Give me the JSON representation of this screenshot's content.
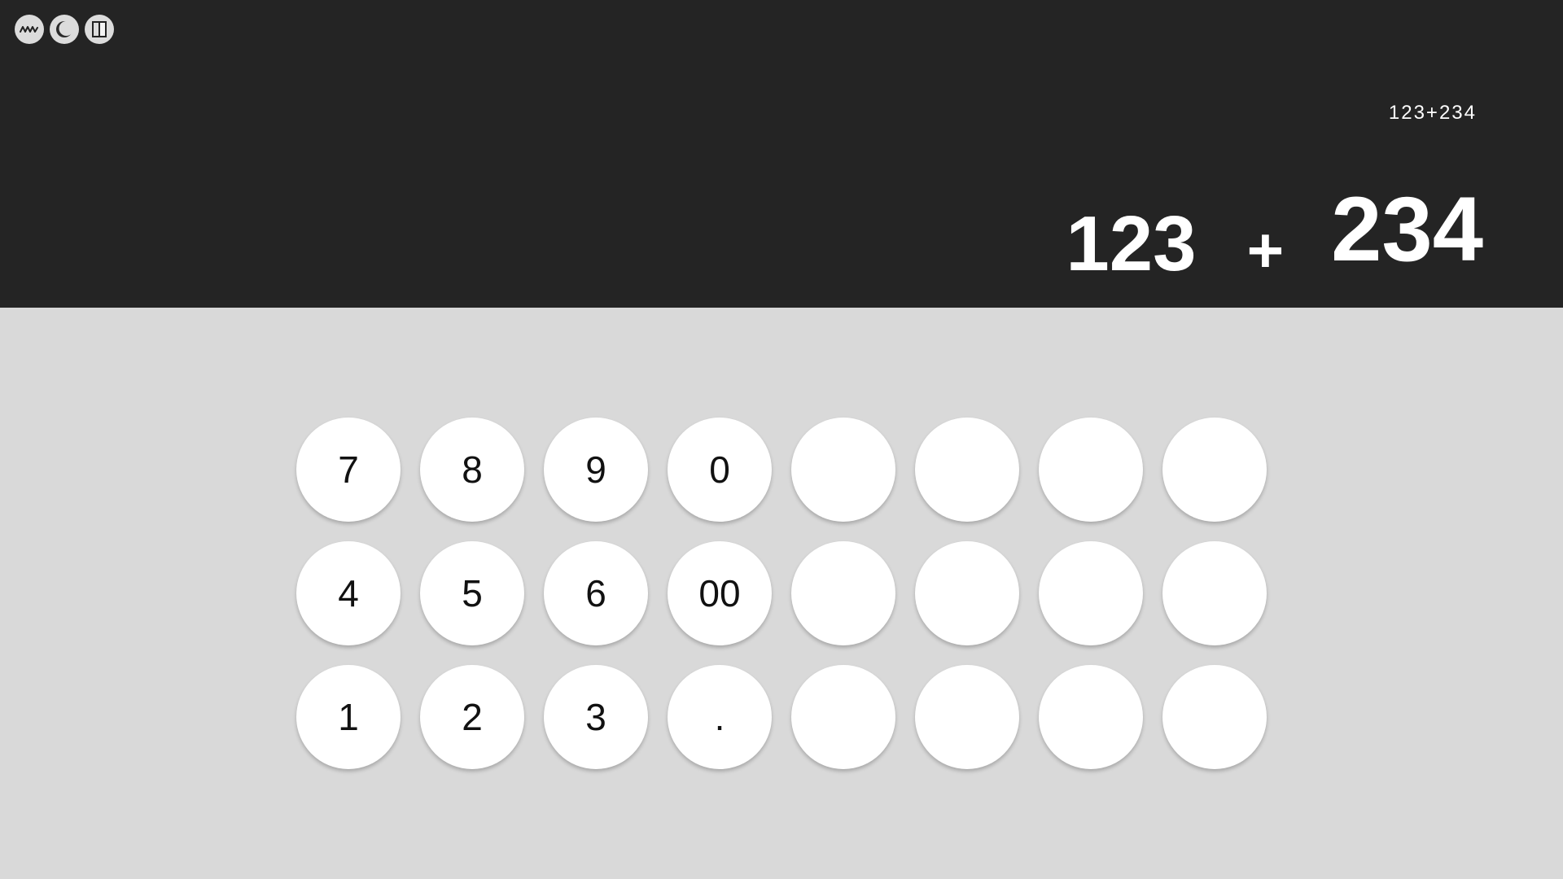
{
  "top_icons": [
    {
      "name": "wave-icon"
    },
    {
      "name": "theme-toggle-icon"
    },
    {
      "name": "split-panel-icon"
    }
  ],
  "display": {
    "expression": "123+234",
    "operand1": "123",
    "operator": "+",
    "operand2": "234"
  },
  "keys": [
    {
      "label": "7"
    },
    {
      "label": "8"
    },
    {
      "label": "9"
    },
    {
      "label": "0"
    },
    {
      "label": ""
    },
    {
      "label": ""
    },
    {
      "label": ""
    },
    {
      "label": ""
    },
    {
      "label": "4"
    },
    {
      "label": "5"
    },
    {
      "label": "6"
    },
    {
      "label": "00"
    },
    {
      "label": ""
    },
    {
      "label": ""
    },
    {
      "label": ""
    },
    {
      "label": ""
    },
    {
      "label": "1"
    },
    {
      "label": "2"
    },
    {
      "label": "3"
    },
    {
      "label": "."
    },
    {
      "label": ""
    },
    {
      "label": ""
    },
    {
      "label": ""
    },
    {
      "label": ""
    }
  ],
  "colors": {
    "display_bg": "#242424",
    "keypad_bg": "#d9d9d9",
    "key_bg": "#ffffff",
    "display_text": "#ffffff"
  }
}
